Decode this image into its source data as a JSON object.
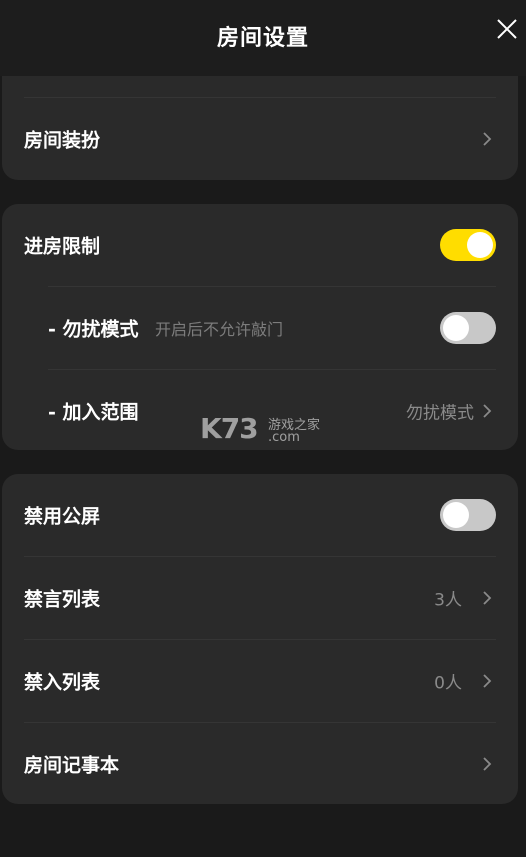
{
  "header": {
    "title": "房间设置",
    "close_icon": "close-icon"
  },
  "section1": {
    "decor_label": "房间装扮"
  },
  "section2": {
    "room_restrict_label": "进房限制",
    "room_restrict_on": true,
    "dnd_label": "- 勿扰模式",
    "dnd_hint": "开启后不允许敲门",
    "dnd_on": false,
    "join_range_label": "- 加入范围",
    "join_range_value": "勿扰模式"
  },
  "section3": {
    "disable_screen_label": "禁用公屏",
    "disable_screen_on": false,
    "mute_list_label": "禁言列表",
    "mute_list_value": "3人",
    "ban_list_label": "禁入列表",
    "ban_list_value": "0人",
    "notes_label": "房间记事本"
  },
  "watermark": {
    "brand": "K73",
    "tagline": "游戏之家",
    "domain": ".com"
  },
  "colors": {
    "accent": "#ffdd00",
    "card": "#2a2a2a",
    "background": "#1a1a1a"
  }
}
